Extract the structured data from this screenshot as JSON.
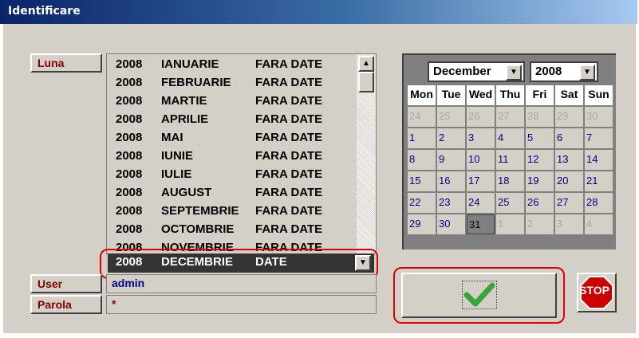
{
  "window": {
    "title": "Identificare"
  },
  "labels": {
    "luna": "Luna",
    "user": "User",
    "parola": "Parola"
  },
  "list": {
    "items": [
      {
        "year": "2008",
        "month": "IANUARIE",
        "status": "FARA DATE"
      },
      {
        "year": "2008",
        "month": "FEBRUARIE",
        "status": "FARA DATE"
      },
      {
        "year": "2008",
        "month": "MARTIE",
        "status": "FARA DATE"
      },
      {
        "year": "2008",
        "month": "APRILIE",
        "status": "FARA DATE"
      },
      {
        "year": "2008",
        "month": "MAI",
        "status": "FARA DATE"
      },
      {
        "year": "2008",
        "month": "IUNIE",
        "status": "FARA DATE"
      },
      {
        "year": "2008",
        "month": "IULIE",
        "status": "FARA DATE"
      },
      {
        "year": "2008",
        "month": "AUGUST",
        "status": "FARA DATE"
      },
      {
        "year": "2008",
        "month": "SEPTEMBRIE",
        "status": "FARA DATE"
      },
      {
        "year": "2008",
        "month": "OCTOMBRIE",
        "status": "FARA DATE"
      },
      {
        "year": "2008",
        "month": "NOVEMBRIE",
        "status": "FARA DATE"
      }
    ],
    "selected": {
      "year": "2008",
      "month": "DECEMBRIE",
      "status": "DATE"
    }
  },
  "fields": {
    "user_value": "admin",
    "password_value": "*"
  },
  "calendar": {
    "month": "December",
    "year": "2008",
    "weekdays": [
      "Mon",
      "Tue",
      "Wed",
      "Thu",
      "Fri",
      "Sat",
      "Sun"
    ],
    "weeks": [
      [
        {
          "d": "24",
          "t": "other"
        },
        {
          "d": "25",
          "t": "other"
        },
        {
          "d": "26",
          "t": "other"
        },
        {
          "d": "27",
          "t": "other"
        },
        {
          "d": "28",
          "t": "other"
        },
        {
          "d": "29",
          "t": "other"
        },
        {
          "d": "30",
          "t": "other"
        }
      ],
      [
        {
          "d": "1",
          "t": "current"
        },
        {
          "d": "2",
          "t": "current"
        },
        {
          "d": "3",
          "t": "current"
        },
        {
          "d": "4",
          "t": "current"
        },
        {
          "d": "5",
          "t": "current"
        },
        {
          "d": "6",
          "t": "current"
        },
        {
          "d": "7",
          "t": "current"
        }
      ],
      [
        {
          "d": "8",
          "t": "current"
        },
        {
          "d": "9",
          "t": "current"
        },
        {
          "d": "10",
          "t": "current"
        },
        {
          "d": "11",
          "t": "current"
        },
        {
          "d": "12",
          "t": "current"
        },
        {
          "d": "13",
          "t": "current"
        },
        {
          "d": "14",
          "t": "current"
        }
      ],
      [
        {
          "d": "15",
          "t": "current"
        },
        {
          "d": "16",
          "t": "current"
        },
        {
          "d": "17",
          "t": "current"
        },
        {
          "d": "18",
          "t": "current"
        },
        {
          "d": "19",
          "t": "current"
        },
        {
          "d": "20",
          "t": "current"
        },
        {
          "d": "21",
          "t": "current"
        }
      ],
      [
        {
          "d": "22",
          "t": "current"
        },
        {
          "d": "23",
          "t": "current"
        },
        {
          "d": "24",
          "t": "current"
        },
        {
          "d": "25",
          "t": "current"
        },
        {
          "d": "26",
          "t": "current"
        },
        {
          "d": "27",
          "t": "current"
        },
        {
          "d": "28",
          "t": "current"
        }
      ],
      [
        {
          "d": "29",
          "t": "current"
        },
        {
          "d": "30",
          "t": "current"
        },
        {
          "d": "31",
          "t": "selected"
        },
        {
          "d": "1",
          "t": "other"
        },
        {
          "d": "2",
          "t": "other"
        },
        {
          "d": "3",
          "t": "other"
        },
        {
          "d": "4",
          "t": "other"
        }
      ]
    ]
  },
  "buttons": {
    "stop_label": "STOP",
    "ok_icon": "checkmark-icon"
  },
  "colors": {
    "label_text": "#800000",
    "user_text": "#000080",
    "highlight_outline": "#e00000",
    "selected_row_bg": "#333333",
    "stop_red": "#cc0000",
    "checkmark_green": "#3aa535"
  }
}
